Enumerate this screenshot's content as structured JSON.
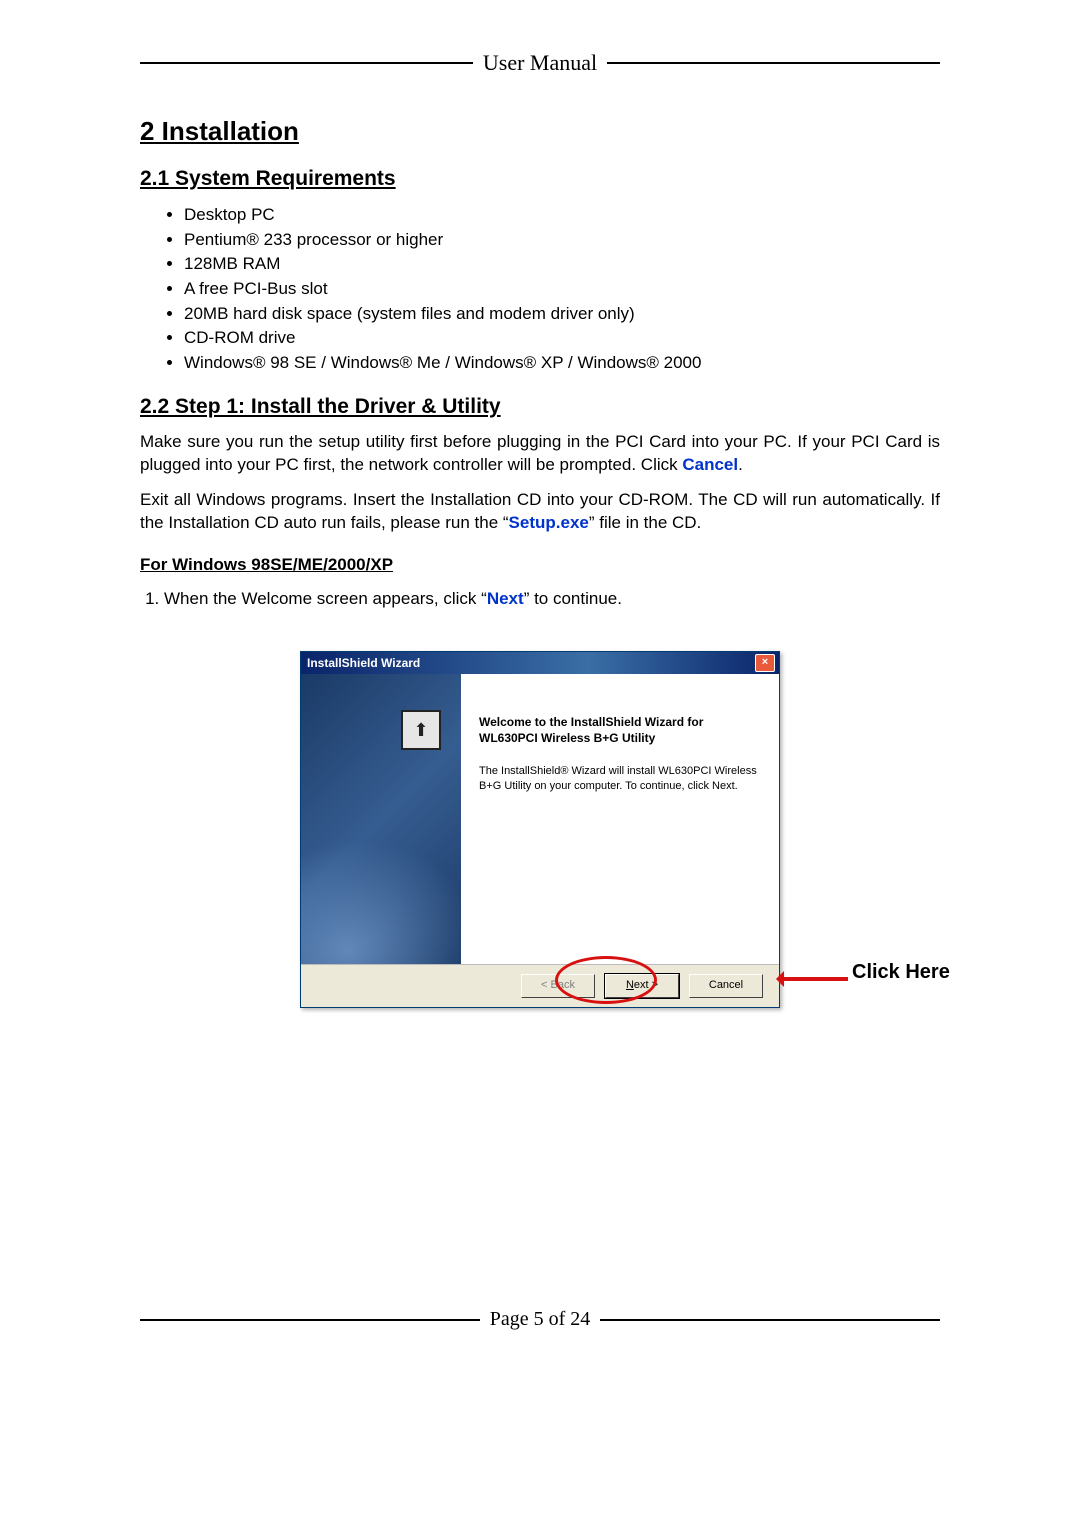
{
  "header": {
    "title": "User Manual"
  },
  "section": {
    "number_title": "2 Installation"
  },
  "sub1": {
    "title": "2.1 System Requirements",
    "items": [
      "Desktop PC",
      "Pentium® 233 processor or higher",
      "128MB RAM",
      "A free PCI-Bus slot",
      "20MB hard disk space (system files and modem driver only)",
      "CD-ROM drive",
      "Windows® 98 SE / Windows® Me / Windows® XP / Windows® 2000"
    ]
  },
  "sub2": {
    "title": "2.2 Step 1: Install the Driver & Utility",
    "para1_a": "Make sure you run the setup utility first before plugging in the PCI Card into your PC. If your PCI Card is plugged into your PC first, the network controller will be prompted. Click ",
    "para1_b": "Cancel",
    "para1_c": ".",
    "para2_a": "Exit all Windows programs. Insert the Installation CD into your CD-ROM. The CD will run automatically. If the Installation CD auto run fails, please run the “",
    "para2_b": "Setup.exe",
    "para2_c": "” file in the CD.",
    "platform_heading": "For Windows 98SE/ME/2000/XP",
    "step1_a": "When the Welcome screen appears, click “",
    "step1_b": "Next",
    "step1_c": "” to continue."
  },
  "dialog": {
    "title": "InstallShield Wizard",
    "welcome": "Welcome to the InstallShield Wizard for WL630PCI Wireless B+G Utility",
    "desc": "The InstallShield® Wizard will install WL630PCI Wireless B+G Utility on your computer.  To continue, click Next.",
    "back": "< Back",
    "next_prefix": "N",
    "next_rest": "ext >",
    "cancel": "Cancel",
    "close": "×"
  },
  "callout": {
    "text": "Click Here"
  },
  "footer": {
    "page": "Page 5 of 24"
  }
}
